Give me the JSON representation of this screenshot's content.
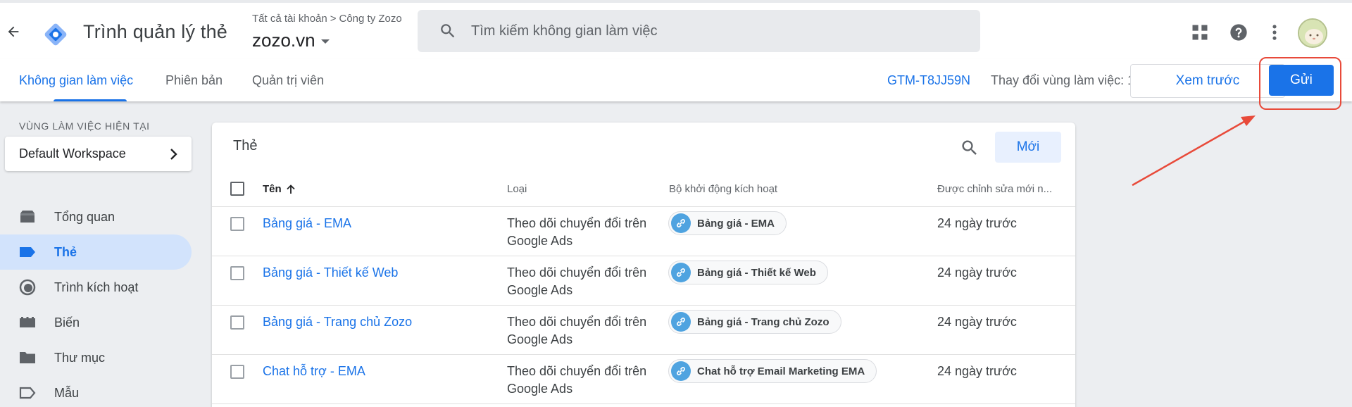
{
  "header": {
    "back_icon": "arrow-left-icon",
    "app_title": "Trình quản lý thẻ",
    "breadcrumb": {
      "account": "Tất cả tài khoản",
      "separator": ">",
      "company": "Công ty Zozo"
    },
    "container_name": "zozo.vn",
    "search_placeholder": "Tìm kiếm không gian làm việc",
    "icons": [
      "apps-grid-icon",
      "help-icon",
      "more-vert-icon"
    ],
    "avatar": "user-avatar"
  },
  "nav": {
    "tabs": [
      {
        "label": "Không gian làm việc",
        "active": true
      },
      {
        "label": "Phiên bản",
        "active": false
      },
      {
        "label": "Quản trị viên",
        "active": false
      }
    ],
    "container_id": "GTM-T8JJ59N",
    "workspace_changes": "Thay đổi vùng làm việc: 1",
    "preview_label": "Xem trước",
    "submit_label": "Gửi"
  },
  "sidebar": {
    "workspace_label": "VÙNG LÀM VIỆC HIỆN TẠI",
    "workspace_name": "Default Workspace",
    "items": [
      {
        "label": "Tổng quan",
        "icon": "overview-icon",
        "active": false
      },
      {
        "label": "Thẻ",
        "icon": "tag-icon",
        "active": true
      },
      {
        "label": "Trình kích hoạt",
        "icon": "trigger-icon",
        "active": false
      },
      {
        "label": "Biến",
        "icon": "variable-icon",
        "active": false
      },
      {
        "label": "Thư mục",
        "icon": "folder-icon",
        "active": false
      },
      {
        "label": "Mẫu",
        "icon": "template-icon",
        "active": false
      }
    ]
  },
  "tags_table": {
    "title": "Thẻ",
    "new_label": "Mới",
    "columns": {
      "name": "Tên",
      "type": "Loại",
      "trigger": "Bộ khởi động kích hoạt",
      "edited": "Được chỉnh sửa mới n..."
    },
    "rows": [
      {
        "name": "Bảng giá - EMA",
        "type": "Theo dõi chuyển đổi trên Google Ads",
        "trigger": "Bảng giá - EMA",
        "edited": "24 ngày trước"
      },
      {
        "name": "Bảng giá - Thiết kế Web",
        "type": "Theo dõi chuyển đổi trên Google Ads",
        "trigger": "Bảng giá - Thiết kế Web",
        "edited": "24 ngày trước"
      },
      {
        "name": "Bảng giá - Trang chủ Zozo",
        "type": "Theo dõi chuyển đổi trên Google Ads",
        "trigger": "Bảng giá - Trang chủ Zozo",
        "edited": "24 ngày trước"
      },
      {
        "name": "Chat hỗ trợ - EMA",
        "type": "Theo dõi chuyển đổi trên Google Ads",
        "trigger": "Chat hỗ trợ Email Marketing EMA",
        "edited": "24 ngày trước"
      }
    ]
  },
  "colors": {
    "accent": "#1a73e8",
    "annotation": "#e84a3a",
    "active_nav_bg": "#d2e3fc"
  }
}
